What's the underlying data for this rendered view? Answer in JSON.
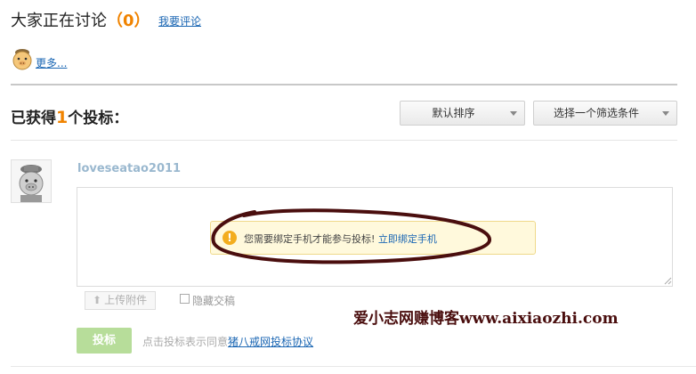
{
  "discussion": {
    "title": "大家正在讨论",
    "paren_open": "（",
    "count": "0",
    "paren_close": "）",
    "comment_link": "我要评论",
    "more_link": "更多..."
  },
  "bids": {
    "heading_pre": "已获得",
    "count": "1",
    "heading_post": "个投标：",
    "sort_label": "默认排序",
    "filter_label": "选择一个筛选条件"
  },
  "bid_form": {
    "username": "loveseatao2011",
    "notice_text": "您需要绑定手机才能参与投标!",
    "notice_link": "立即绑定手机",
    "attach_label": "上传附件",
    "hide_label": "隐藏交稿",
    "submit_label": "投标",
    "agree_text": "点击投标表示同意",
    "agree_link": "猪八戒网投标协议"
  },
  "watermark": "爱小志网赚博客www.aixiaozhi.com",
  "colors": {
    "accent_orange": "#f08300",
    "link_blue": "#1a66b3",
    "submit_green": "#b7dd9a",
    "notice_bg": "#fff9dc",
    "annotation_brown": "#4a0e0e"
  },
  "icons": {
    "small_avatar": "pig-avatar-icon",
    "user_avatar": "pig-avatar-icon",
    "notice": "warning-icon",
    "attach": "upload-arrow-icon"
  }
}
